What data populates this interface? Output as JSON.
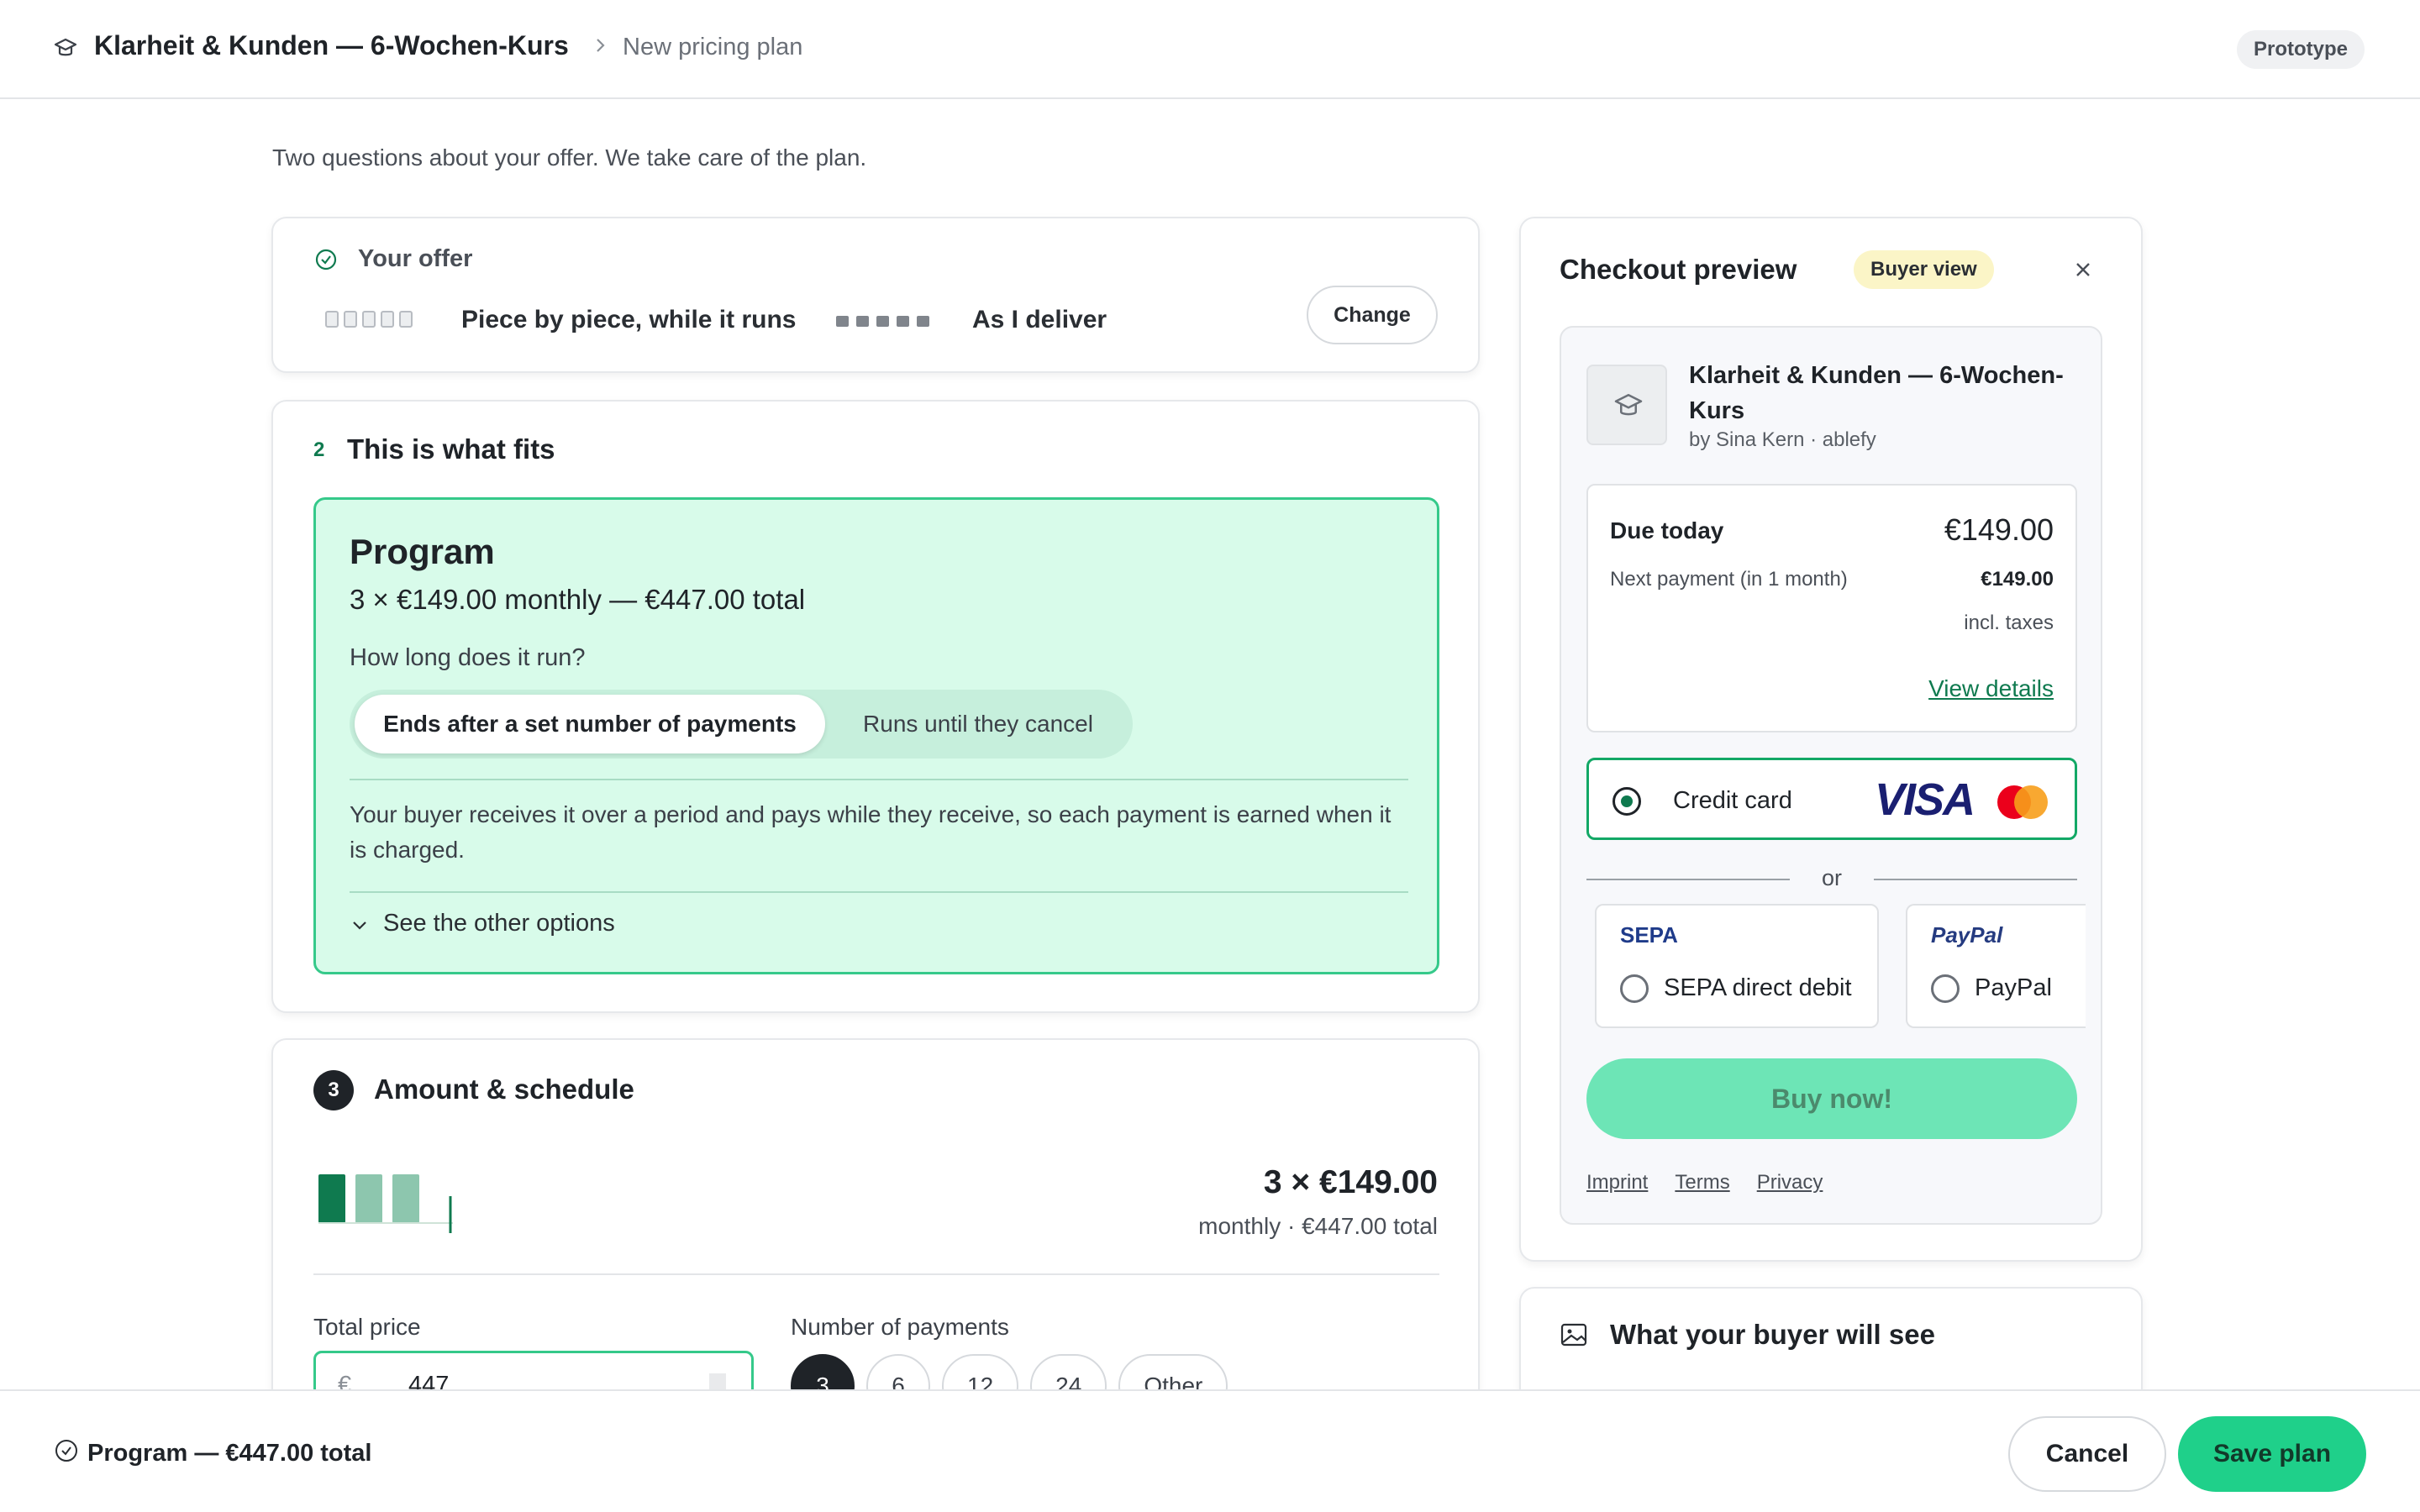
{
  "header": {
    "course_title": "Klarheit & Kunden — 6-Wochen-Kurs",
    "breadcrumb": "New pricing plan",
    "badge": "Prototype"
  },
  "intro": "Two questions about your offer. We take care of the plan.",
  "offer": {
    "label": "Your offer",
    "option_delivery": "Piece by piece, while it runs",
    "option_payment": "As I deliver",
    "change_label": "Change"
  },
  "fits": {
    "step": "2",
    "heading": "This is what fits",
    "program": {
      "title": "Program",
      "summary": "3 × €149.00 monthly — €447.00 total",
      "question": "How long does it run?",
      "options": [
        "Ends after a set number of payments",
        "Runs until they cancel"
      ],
      "selected_option": "Ends after a set number of payments",
      "description": "Your buyer receives it over a period and pays while they receive, so each payment is earned when it is charged.",
      "more_label": "See the other options"
    }
  },
  "amount": {
    "step": "3",
    "heading": "Amount & schedule",
    "headline": "3 × €149.00",
    "subline": "monthly · €447.00 total",
    "total_price_label": "Total price",
    "currency": "€",
    "total_price_value": "447",
    "payments_label": "Number of payments",
    "payment_options": [
      "3",
      "6",
      "12",
      "24",
      "Other"
    ],
    "selected_payments": "3",
    "schedule_bars": 3
  },
  "checkout": {
    "title": "Checkout preview",
    "badge": "Buyer view",
    "product_name": "Klarheit & Kunden — 6-Wochen-Kurs",
    "product_by": "by Sina Kern · ablefy",
    "due_today_label": "Due today",
    "due_today_value": "€149.00",
    "next_payment_label": "Next payment (in 1 month)",
    "next_payment_value": "€149.00",
    "taxes_note": "incl. taxes",
    "details_link": "View details",
    "credit_card_label": "Credit card",
    "card_brand": "VISA",
    "or_label": "or",
    "sepa_logo": "SEPA",
    "sepa_label": "SEPA direct debit",
    "paypal_logo": "PayPal",
    "paypal_label": "PayPal",
    "buy_label": "Buy now!",
    "legal_links": [
      "Imprint",
      "Terms",
      "Privacy"
    ]
  },
  "buyer_see": {
    "title": "What your buyer will see"
  },
  "footer": {
    "summary": "Program — €447.00 total",
    "cancel_label": "Cancel",
    "save_label": "Save plan"
  },
  "colors": {
    "accent": "#1fd08a",
    "accent_dark": "#0f7a4f",
    "program_bg": "#d8fbea",
    "program_border": "#35c98a",
    "buy_disabled": "#6de5b6"
  }
}
